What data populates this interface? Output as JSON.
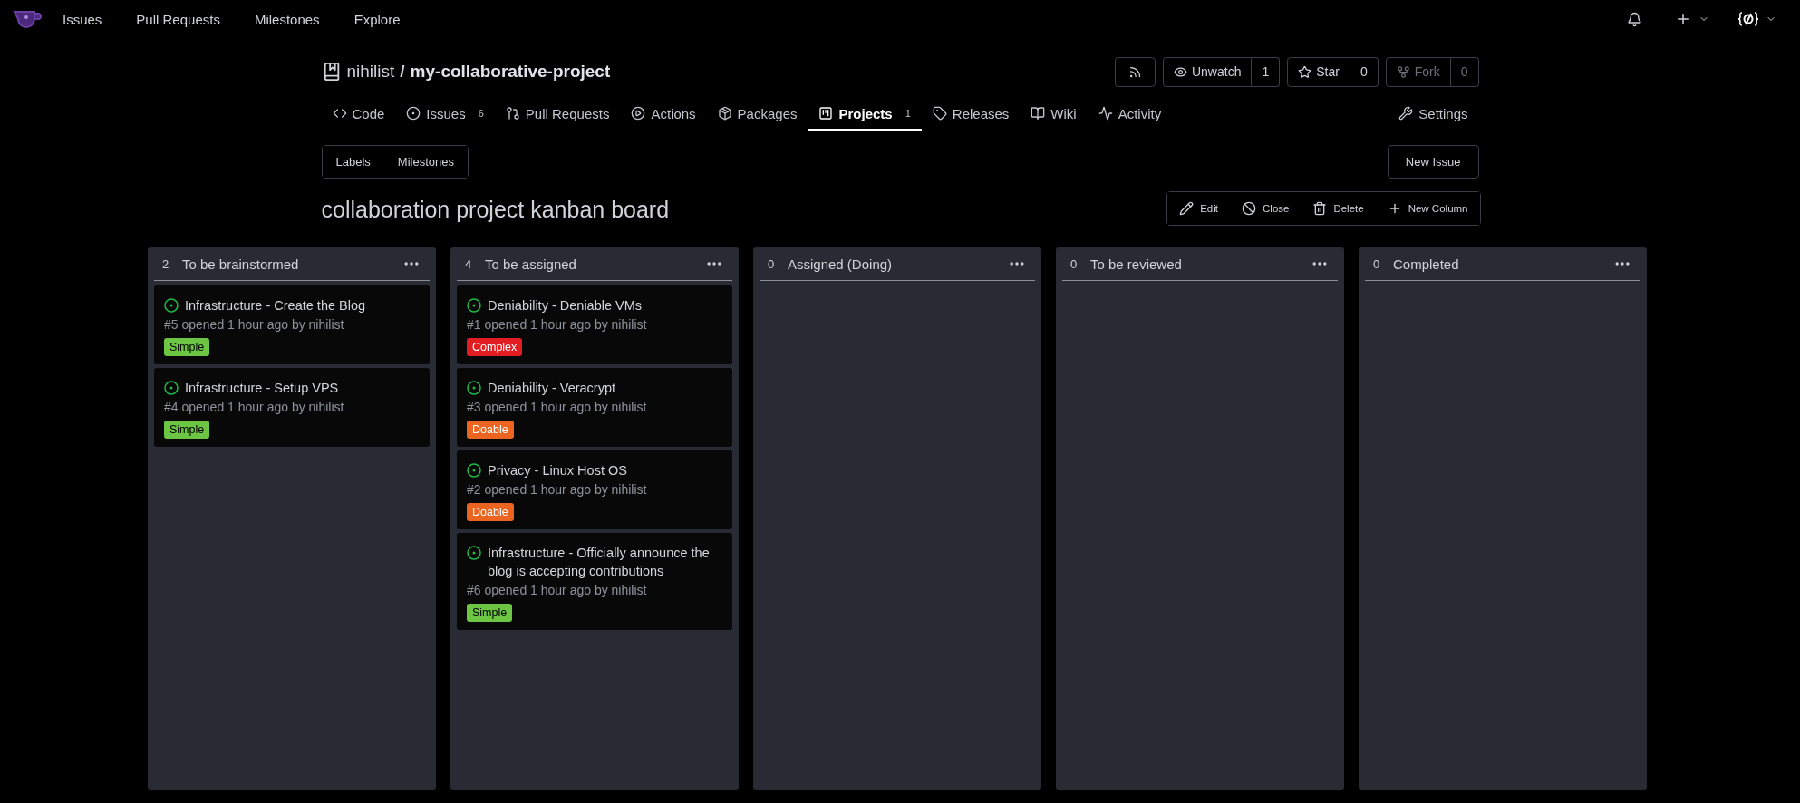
{
  "nav": {
    "items": [
      "Issues",
      "Pull Requests",
      "Milestones",
      "Explore"
    ]
  },
  "repo": {
    "owner": "nihilist",
    "separator": "/",
    "name": "my-collaborative-project",
    "actions": [
      {
        "kind": "rss",
        "disabled": false
      },
      {
        "kind": "watch",
        "label": "Unwatch",
        "count": "1",
        "disabled": false
      },
      {
        "kind": "star",
        "label": "Star",
        "count": "0",
        "disabled": false
      },
      {
        "kind": "fork",
        "label": "Fork",
        "count": "0",
        "disabled": true
      }
    ]
  },
  "tabs": [
    {
      "kind": "code",
      "label": "Code",
      "selected": false
    },
    {
      "kind": "issues",
      "label": "Issues",
      "count": "6",
      "selected": false
    },
    {
      "kind": "pulls",
      "label": "Pull Requests",
      "selected": false
    },
    {
      "kind": "actions",
      "label": "Actions",
      "selected": false
    },
    {
      "kind": "packages",
      "label": "Packages",
      "selected": false
    },
    {
      "kind": "projects",
      "label": "Projects",
      "count": "1",
      "selected": true
    },
    {
      "kind": "releases",
      "label": "Releases",
      "selected": false
    },
    {
      "kind": "wiki",
      "label": "Wiki",
      "selected": false
    },
    {
      "kind": "activity",
      "label": "Activity",
      "selected": false
    }
  ],
  "settings_tab": {
    "label": "Settings",
    "selected": false
  },
  "subnav": [
    "Labels",
    "Milestones"
  ],
  "new_issue": "New Issue",
  "project": {
    "title": "collaboration project kanban board",
    "actions": [
      {
        "kind": "edit",
        "label": "Edit"
      },
      {
        "kind": "close",
        "label": "Close"
      },
      {
        "kind": "delete",
        "label": "Delete"
      },
      {
        "kind": "add",
        "label": "New Column"
      }
    ]
  },
  "columns": [
    {
      "count": "2",
      "title": "To be brainstormed",
      "cards": [
        {
          "title": "Infrastructure - Create the Blog",
          "meta": "#5 opened 1 hour ago by nihilist",
          "label": {
            "text": "Simple",
            "color": "#6cc644"
          }
        },
        {
          "title": "Infrastructure - Setup VPS",
          "meta": "#4 opened 1 hour ago by nihilist",
          "label": {
            "text": "Simple",
            "color": "#6cc644"
          }
        }
      ]
    },
    {
      "count": "4",
      "title": "To be assigned",
      "cards": [
        {
          "title": "Deniability - Deniable VMs",
          "meta": "#1 opened 1 hour ago by nihilist",
          "label": {
            "text": "Complex",
            "color": "#e11d21"
          }
        },
        {
          "title": "Deniability - Veracrypt",
          "meta": "#3 opened 1 hour ago by nihilist",
          "label": {
            "text": "Doable",
            "color": "#eb6420"
          }
        },
        {
          "title": "Privacy - Linux Host OS",
          "meta": "#2 opened 1 hour ago by nihilist",
          "label": {
            "text": "Doable",
            "color": "#eb6420"
          }
        },
        {
          "title": "Infrastructure - Officially announce the blog is accepting contributions",
          "meta": "#6 opened 1 hour ago by nihilist",
          "label": {
            "text": "Simple",
            "color": "#6cc644"
          }
        }
      ]
    },
    {
      "count": "0",
      "title": "Assigned (Doing)"
    },
    {
      "count": "0",
      "title": "To be reviewed"
    },
    {
      "count": "0",
      "title": "Completed"
    }
  ]
}
